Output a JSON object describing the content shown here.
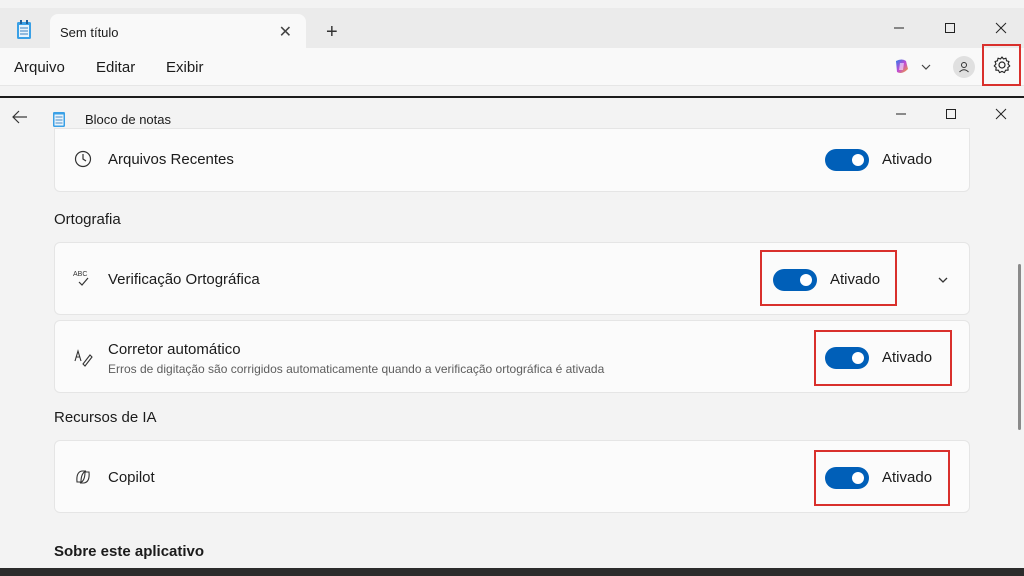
{
  "notepad": {
    "tab_title": "Sem título",
    "menu": [
      "Arquivo",
      "Editar",
      "Exibir"
    ]
  },
  "settings_window": {
    "title": "Bloco de notas"
  },
  "settings": {
    "recent_files": {
      "title": "Arquivos Recentes",
      "state": "Ativado"
    },
    "spelling_section": "Ortografia",
    "spellcheck": {
      "title": "Verificação Ortográfica",
      "state": "Ativado"
    },
    "autocorrect": {
      "title": "Corretor automático",
      "subtitle": "Erros de digitação são corrigidos automaticamente quando a verificação ortográfica é ativada",
      "state": "Ativado"
    },
    "ai_section": "Recursos de IA",
    "copilot": {
      "title": "Copilot",
      "state": "Ativado"
    },
    "about_section": "Sobre este aplicativo"
  },
  "colors": {
    "accent": "#005fb8",
    "highlight": "#d9302c"
  }
}
